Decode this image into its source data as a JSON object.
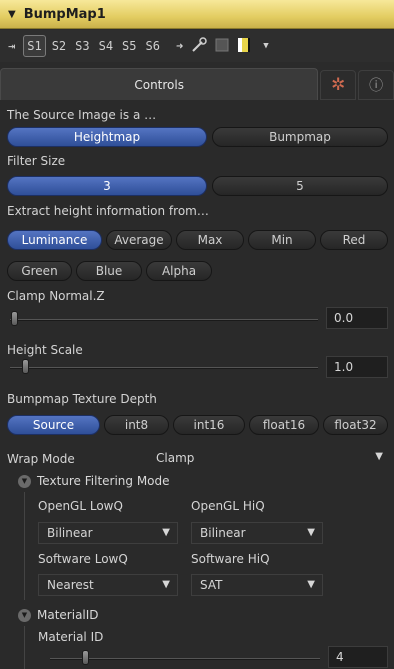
{
  "title": "BumpMap1",
  "toolbar": {
    "slots": [
      "S1",
      "S2",
      "S3",
      "S4",
      "S5",
      "S6"
    ],
    "active_slot": "S1"
  },
  "tabs": {
    "controls": "Controls"
  },
  "source": {
    "label": "The Source Image is a …",
    "options": [
      "Heightmap",
      "Bumpmap"
    ],
    "selected": "Heightmap"
  },
  "filter": {
    "label": "Filter Size",
    "options": [
      "3",
      "5"
    ],
    "selected": "3"
  },
  "extract": {
    "label": "Extract height information from…",
    "row1": [
      "Luminance",
      "Average",
      "Max",
      "Min",
      "Red"
    ],
    "row2": [
      "Green",
      "Blue",
      "Alpha"
    ],
    "selected": "Luminance"
  },
  "clamp": {
    "label": "Clamp Normal.Z",
    "value": "0.0"
  },
  "height": {
    "label": "Height Scale",
    "value": "1.0"
  },
  "depth": {
    "label": "Bumpmap Texture Depth",
    "options": [
      "Source",
      "int8",
      "int16",
      "float16",
      "float32"
    ],
    "selected": "Source"
  },
  "wrap": {
    "label": "Wrap Mode",
    "value": "Clamp"
  },
  "texture_filtering": {
    "heading": "Texture Filtering Mode",
    "opengl_lowq_label": "OpenGL LowQ",
    "opengl_lowq_value": "Bilinear",
    "opengl_hiq_label": "OpenGL HiQ",
    "opengl_hiq_value": "Bilinear",
    "software_lowq_label": "Software LowQ",
    "software_lowq_value": "Nearest",
    "software_hiq_label": "Software HiQ",
    "software_hiq_value": "SAT"
  },
  "material": {
    "heading": "MaterialID",
    "label": "Material ID",
    "value": "4"
  },
  "colors": {
    "title_bar": "#e3cd62",
    "selected_button": "#3f5fad",
    "gear_icon": "#d06a50"
  },
  "icons": [
    "collapse-triangle-icon",
    "pin-icon",
    "arrow-right-icon",
    "eyedropper-icon",
    "disable-icon",
    "color-swatch-icon",
    "gear-icon",
    "info-icon"
  ]
}
